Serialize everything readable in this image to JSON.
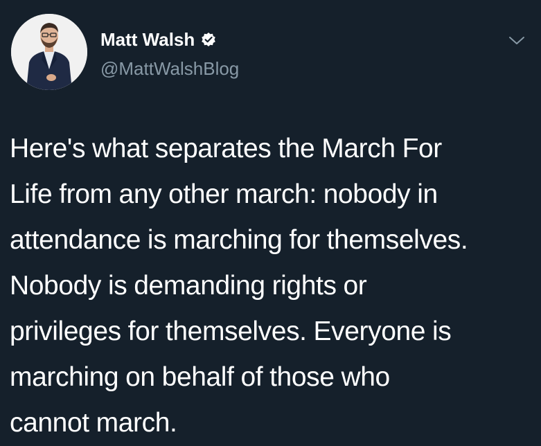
{
  "author": {
    "name": "Matt Walsh",
    "handle": "@MattWalshBlog",
    "verified": true
  },
  "icons": {
    "verified": "verified-badge-icon",
    "menu": "chevron-down-icon"
  },
  "tweet": {
    "lines": [
      "Here's what separates the March For",
      "Life from any other march: nobody in",
      "attendance is marching for themselves.",
      "Nobody is demanding rights or",
      "privileges for themselves. Everyone is",
      "marching on behalf of those who",
      "cannot march."
    ]
  },
  "colors": {
    "background": "#15202b",
    "text": "#ffffff",
    "secondary_text": "#8899a6",
    "chevron": "#8899a6"
  }
}
